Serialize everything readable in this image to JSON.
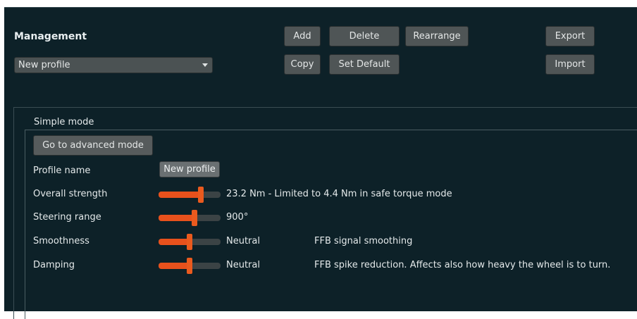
{
  "management": {
    "title": "Management",
    "profile_select": "New profile",
    "buttons": {
      "add": "Add",
      "delete": "Delete",
      "rearrange": "Rearrange",
      "export": "Export",
      "copy": "Copy",
      "set_default": "Set Default",
      "import": "Import"
    }
  },
  "simple_mode": {
    "title": "Simple mode",
    "advanced_button": "Go to advanced mode",
    "profile_name_label": "Profile name",
    "profile_name_value": "New profile",
    "sliders": [
      {
        "label": "Overall strength",
        "value_text": "23.2 Nm - Limited to 4.4 Nm in safe torque mode",
        "description": "",
        "level": 0.68
      },
      {
        "label": "Steering range",
        "value_text": "900°",
        "description": "",
        "level": 0.58
      },
      {
        "label": "Smoothness",
        "value_text": "Neutral",
        "description": "FFB signal smoothing",
        "level": 0.5
      },
      {
        "label": "Damping",
        "value_text": "Neutral",
        "description": "FFB spike reduction. Affects also how heavy the wheel is to turn.",
        "level": 0.5
      }
    ]
  },
  "colors": {
    "background": "#0d2128",
    "button": "#4f5556",
    "accent": "#e8511c"
  }
}
